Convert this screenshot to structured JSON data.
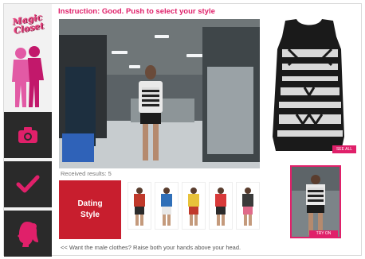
{
  "app": {
    "logo_text": "Magic Closet",
    "instruction": "Instruction: Good. Push to select your style"
  },
  "sidebar": {
    "items": [
      {
        "name": "camera",
        "icon": "camera-icon"
      },
      {
        "name": "confirm",
        "icon": "check-icon"
      },
      {
        "name": "style",
        "icon": "female-head-icon"
      }
    ]
  },
  "results": {
    "label": "Received results: 5",
    "style_label_line1": "Dating",
    "style_label_line2": "Style",
    "thumbnails": [
      {
        "top": "#c0392b",
        "bottom": "#2b2b2b"
      },
      {
        "top": "#2f6fb8",
        "bottom": "#e8e8e8"
      },
      {
        "top": "#e8c23a",
        "bottom": "#c0392b"
      },
      {
        "top": "#d83a3a",
        "bottom": "#2b2b2b"
      },
      {
        "top": "#3a3a3a",
        "bottom": "#e06a8a"
      }
    ]
  },
  "garment": {
    "tag": "SEE ALL"
  },
  "preview": {
    "badge": "TRY ON"
  },
  "hint": "<< Want the male clothes? Raise both your hands above your head.",
  "colors": {
    "accent": "#e0206a",
    "style_tile": "#c81e2e",
    "sidebar_button": "#2a2a2a"
  }
}
